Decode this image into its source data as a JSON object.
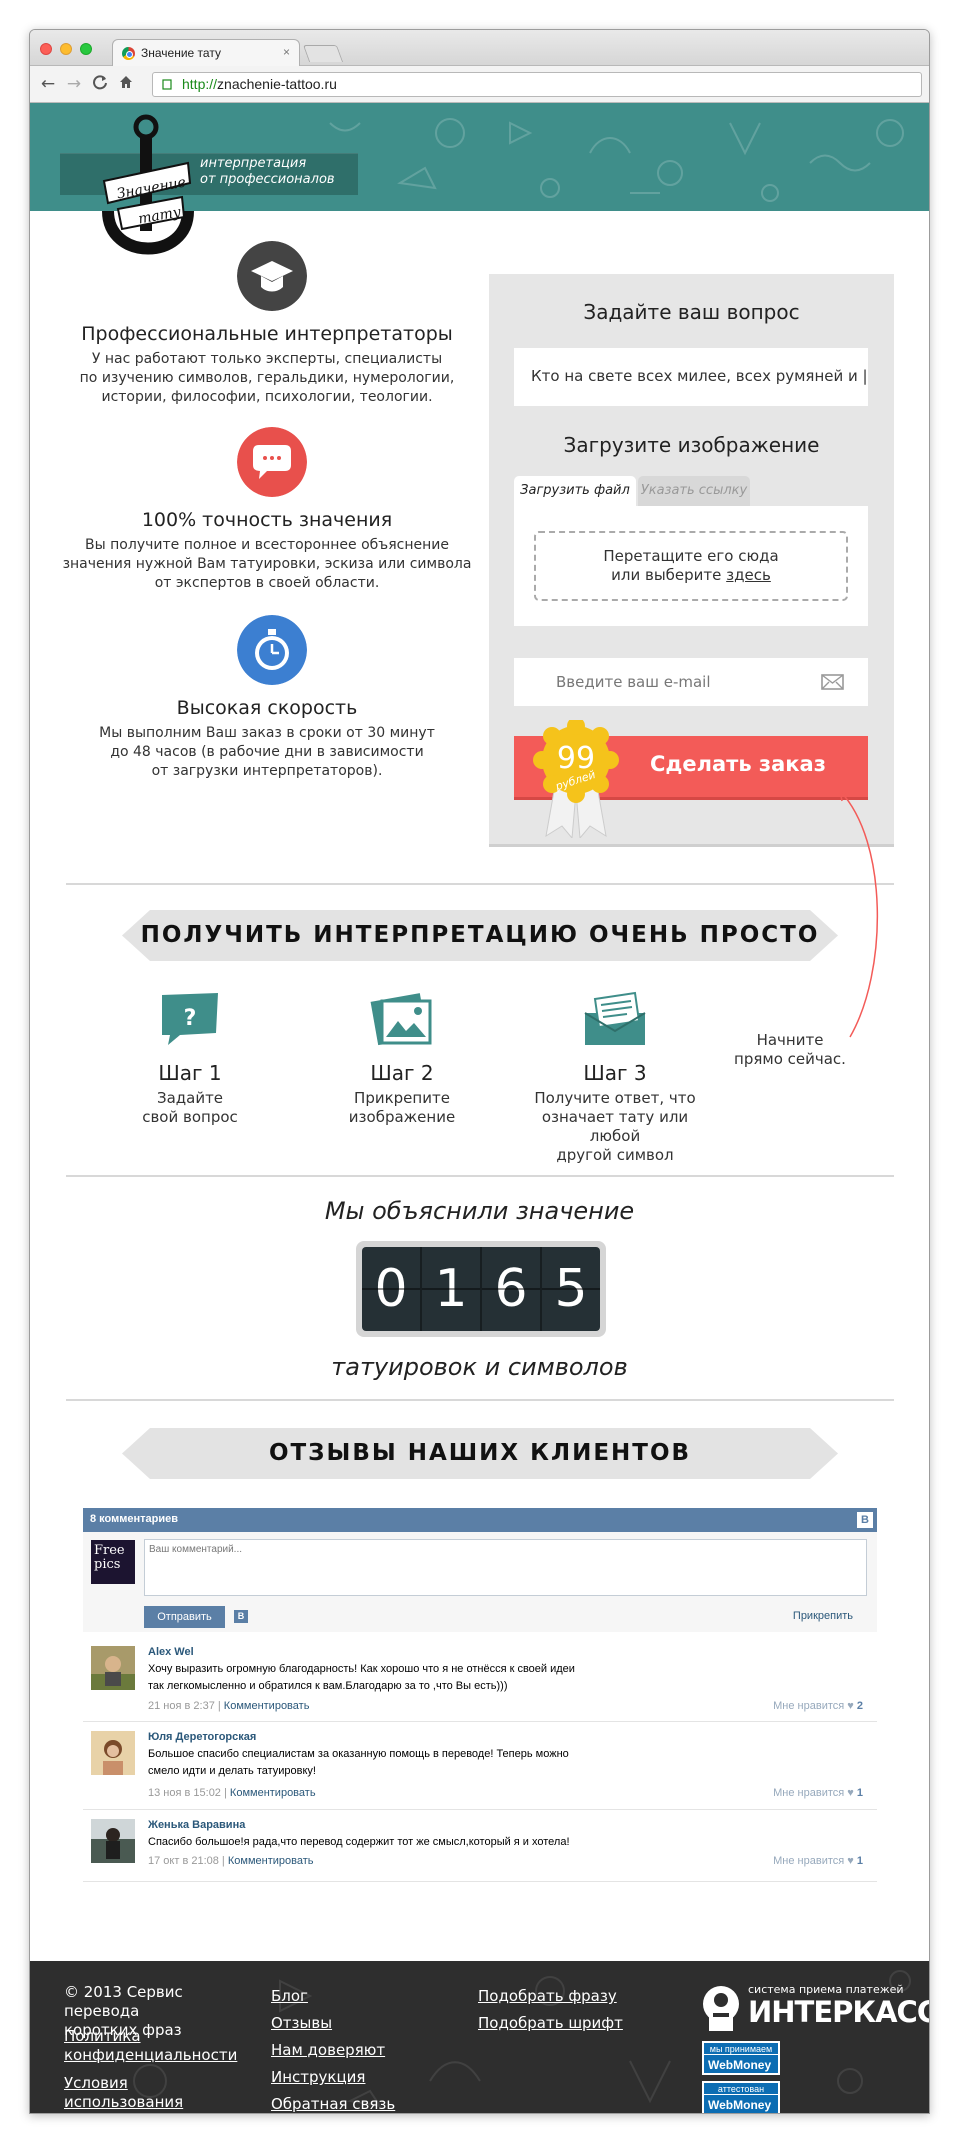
{
  "browser": {
    "tab_title": "Значение тату",
    "tab_close": "×",
    "url_scheme": "http://",
    "url_host": "znachenie-tattoo.ru",
    "back": "←",
    "forward": "→",
    "reload": "C",
    "home": "⌂"
  },
  "header": {
    "logo_line1": "Значение",
    "logo_line2": "тату",
    "tagline_line1": "интерпретация",
    "tagline_line2": "от профессионалов",
    "bg_color": "#3f8e8a"
  },
  "features": [
    {
      "icon": "graduation-cap-icon",
      "title": "Профессиональные интерпретаторы",
      "line1": "У нас работают только эксперты, специалисты",
      "line2": "по изучению символов, геральдики, нумерологии,",
      "line3": "истории, философии, психологии, теологии."
    },
    {
      "icon": "chat-bubble-icon",
      "title": "100% точность значения",
      "line1": "Вы получите полное и всестороннее объяснение",
      "line2": "значения нужной Вам татуировки, эскиза или символа",
      "line3": "от экспертов в своей области."
    },
    {
      "icon": "stopwatch-icon",
      "title": "Высокая скорость",
      "line1": "Мы выполним Ваш заказ в сроки от 30 минут",
      "line2": "до 48 часов (в рабочие дни в зависимости",
      "line3": "от загрузки интерпретаторов)."
    }
  ],
  "order_form": {
    "question_heading": "Задайте ваш вопрос",
    "question_value": "Кто на свете всех милее, всех румяней и",
    "upload_heading": "Загрузите изображение",
    "tab_file": "Загрузить файл",
    "tab_link": "Указать ссылку",
    "drop_line1": "Перетащите его сюда",
    "drop_line2_prefix": "или выберите ",
    "drop_link": "здесь",
    "email_placeholder": "Введите ваш e-mail",
    "order_button": "Сделать заказ",
    "price": "99",
    "currency": "рублей",
    "accent_color": "#f35b58"
  },
  "how_it_works": {
    "title": "ПОЛУЧИТЬ ИНТЕРПРЕТАЦИЮ ОЧЕНЬ ПРОСТО",
    "steps": [
      {
        "icon": "question-bubble-icon",
        "title": "Шаг 1",
        "line1": "Задайте",
        "line2": "свой вопрос",
        "line3": ""
      },
      {
        "icon": "photo-icon",
        "title": "Шаг 2",
        "line1": "Прикрепите",
        "line2": "изображение",
        "line3": ""
      },
      {
        "icon": "envelope-icon",
        "title": "Шаг 3",
        "line1": "Получите ответ, что",
        "line2": "означает тату или любой",
        "line3": "другой символ"
      }
    ],
    "start_line1": "Начните",
    "start_line2": "прямо сейчас."
  },
  "counter": {
    "caption_top": "Мы объяснили значение",
    "digits": [
      "0",
      "1",
      "6",
      "5"
    ],
    "caption_bottom": "татуировок и символов"
  },
  "reviews": {
    "title": "ОТЗЫВЫ НАШИХ КЛИЕНТОВ",
    "widget_header": "8 комментариев",
    "vk_letter": "В",
    "self_avatar_line1": "Free",
    "self_avatar_line2": "pics",
    "comment_placeholder": "Ваш комментарий...",
    "send_label": "Отправить",
    "attach_label": "Прикрепить",
    "comments": [
      {
        "name": "Alex Wel",
        "line1": "Хочу выразить огромную благодарность! Как хорошо что я не отнёсся к своей идеи",
        "line2": "так легкомысленно и обратился к вам.Благодарю за то ,что Вы есть)))",
        "date": "21 ноя в 2:37",
        "sep": " | ",
        "reply": "Комментировать",
        "like_label": "Мне нравится ♥",
        "likes": "2"
      },
      {
        "name": "Юля Деретогорская",
        "line1": "Большое спасибо специалистам за оказанную помощь в переводе! Теперь можно",
        "line2": "смело идти и делать татуировку!",
        "date": "13 ноя в 15:02",
        "sep": " | ",
        "reply": "Комментировать",
        "like_label": "Мне нравится ♥",
        "likes": "1"
      },
      {
        "name": "Женька Варавина",
        "line1": "Спасибо большое!я рада,что перевод содержит тот же смысл,который я и хотела!",
        "line2": "",
        "date": "17 окт в 21:08",
        "sep": " | ",
        "reply": "Комментировать",
        "like_label": "Мне нравится ♥",
        "likes": "1"
      }
    ]
  },
  "footer": {
    "copyright_line1": "© 2013 Сервис перевода",
    "copyright_line2": "коротких фраз",
    "col1": [
      "Политика конфиденциальности",
      "Условия использования"
    ],
    "col2": [
      "Блог",
      "Отзывы",
      "Нам доверяют",
      "Инструкция",
      "Обратная связь"
    ],
    "col3": [
      "Подобрать фразу",
      "Подобрать шрифт"
    ],
    "payment_tagline": "система приема платежей",
    "payment_name": "ИНТЕРКАССА",
    "badge1_top": "мы принимаем",
    "badge1_name": "WebMoney",
    "badge2_top": "аттестован",
    "badge2_name": "WebMoney"
  }
}
